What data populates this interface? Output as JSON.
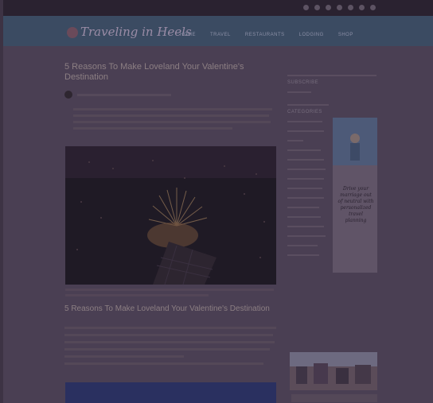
{
  "site": {
    "logo_text": "Traveling in Heels",
    "nav": [
      "HOME",
      "TRAVEL",
      "RESTAURANTS",
      "LODGING",
      "SHOP"
    ]
  },
  "post": {
    "title": "5 Reasons To Make Loveland Your Valentine's Destination",
    "section_title": "5 Reasons To Make Loveland Your Valentine's Destination"
  },
  "sidebar": {
    "subscribe_heading": "SUBSCRIBE",
    "categories_heading": "CATEGORIES",
    "ad_text": "Drive your marriage out of neutral with personalized travel planning"
  },
  "colors": {
    "topbar": "#2a2230",
    "header": "#3b4b62",
    "page": "#4a3f53"
  }
}
